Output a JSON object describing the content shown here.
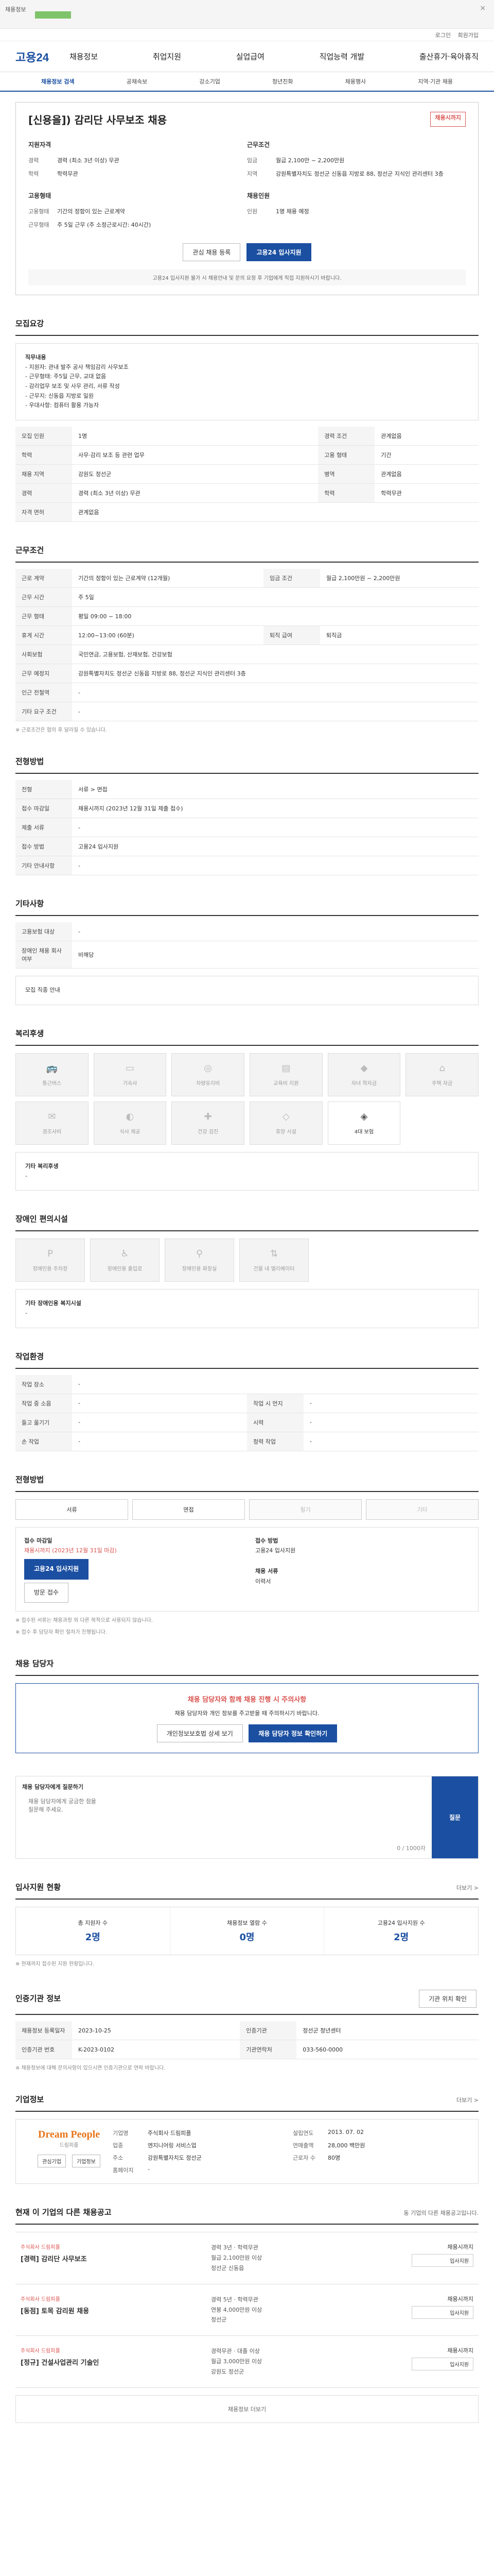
{
  "banner": {
    "label": "채용정보",
    "close": "×"
  },
  "util": {
    "items": [
      "로그인",
      "회원가입"
    ]
  },
  "gnb": {
    "logo": "고용24",
    "menu": [
      "채용정보",
      "취업지원",
      "실업급여",
      "직업능력 개발",
      "출산휴가·육아휴직"
    ]
  },
  "lnb": {
    "items": [
      "채용정보 검색",
      "공채속보",
      "강소기업",
      "청년친화",
      "채용행사",
      "지역·기관 채용"
    ],
    "active": 0
  },
  "job": {
    "title": "[신용을]) 감리단 사무보조 채용",
    "status": "채용시까지",
    "left_head": "지원자격",
    "right_head": "근무조건",
    "left": [
      {
        "k": "경력",
        "v": "경력 (최소 3년 이상) 무관"
      },
      {
        "k": "학력",
        "v": "학력무관"
      }
    ],
    "right": [
      {
        "k": "임금",
        "v": "월급 2,100만 ~ 2,200만원"
      },
      {
        "k": "지역",
        "v": "강원특별자치도 정선군 신동읍 지방로 88, 정선군 지식인 관리센터 3층"
      }
    ],
    "left2_head": "고용형태",
    "left2": [
      {
        "k": "고용형태",
        "v": "기간의 정함이 있는 근로계약"
      },
      {
        "k": "근무형태",
        "v": "주 5일 근무 (주 소정근로시간: 40시간)"
      }
    ],
    "right2_head": "채용인원",
    "right2": [
      {
        "k": "인원",
        "v": "1명 채용 예정"
      }
    ],
    "btn_interest": "관심 채용 등록",
    "btn_apply": "고용24 입사지원",
    "notice": "고용24 입사지원 불가 시 채용안내 및 문의 요청 후 기업에게 직접 지원하시기 바랍니다."
  },
  "recruit": {
    "title": "모집요강",
    "desc_title": "직무내용",
    "desc": [
      "- 지원자: 관내 발주 공사 책임감리 사무보조",
      "- 근무형태: 주5일 근무, 교대 없음",
      "- 감리업무 보조 및 사무 관리, 서류 작성",
      "- 근무지: 신동읍 지방로 일원",
      "- 우대사항: 컴퓨터 활용 가능자"
    ],
    "rows": [
      {
        "k": "모집 인원",
        "v": "1명",
        "k2": "경력 조건",
        "v2": "관계없음"
      },
      {
        "k": "학력",
        "v": "사무·감리 보조 등 관련 업무",
        "k2": "고용 형태",
        "v2": "기간"
      },
      {
        "k": "채용 지역",
        "v": "강원도 정선군",
        "k2": "병역",
        "v2": "관계없음"
      },
      {
        "k": "경력",
        "v": "경력 (최소 3년 이상) 무관",
        "k2": "학력",
        "v2": "학력무관"
      },
      {
        "k": "자격 면허",
        "v": "관계없음",
        "k2": "",
        "v2": ""
      }
    ]
  },
  "conditions": {
    "title": "근무조건",
    "rows": [
      {
        "k": "근로 계약",
        "v": "기간의 정함이 있는 근로계약 (12개월)",
        "k2": "임금 조건",
        "v2": "월급 2,100만원 ~ 2,200만원"
      },
      {
        "k": "근무 시간",
        "v": "주 5일",
        "k2": "",
        "v2": ""
      },
      {
        "k": "근무 형태",
        "v": "평일 09:00 ~ 18:00",
        "k2": "",
        "v2": ""
      },
      {
        "k": "휴게 시간",
        "v": "12:00~13:00 (60분)",
        "k2": "퇴직 급여",
        "v2": "퇴직금"
      },
      {
        "k": "사회보험",
        "v": "국민연금, 고용보험, 산재보험, 건강보험",
        "k2": "",
        "v2": ""
      },
      {
        "k": "근무 예정지",
        "v": "강원특별자치도 정선군 신동읍 지방로 88, 정선군 지식인 관리센터 3층",
        "k2": "",
        "v2": ""
      },
      {
        "k": "인근 전철역",
        "v": "-",
        "k2": "",
        "v2": ""
      },
      {
        "k": "기타 요구 조건",
        "v": "-",
        "k2": "",
        "v2": ""
      }
    ],
    "note": "※ 근로조건은 협의 후 달라질 수 있습니다."
  },
  "selection": {
    "title": "전형방법",
    "rows": [
      {
        "k": "전형",
        "v": "서류 > 면접"
      },
      {
        "k": "접수 마감일",
        "v": "채용시까지 (2023년 12월 31일 제출 접수)"
      },
      {
        "k": "제출 서류",
        "v": "-"
      },
      {
        "k": "접수 방법",
        "v": "고용24 입사지원"
      },
      {
        "k": "기타 안내사항",
        "v": "-"
      }
    ]
  },
  "etc": {
    "title": "기타사항",
    "rows": [
      {
        "k": "고용보험 대상",
        "v": "-"
      },
      {
        "k": "장애인 채용 회사 여부",
        "v": "비해당"
      }
    ],
    "link": "모집 직종 안내"
  },
  "welfare": {
    "title": "복리후생",
    "items": [
      {
        "name": "통근버스",
        "icon": "bus-icon",
        "on": false
      },
      {
        "name": "기숙사",
        "icon": "dorm-icon",
        "on": false
      },
      {
        "name": "차량유지비",
        "icon": "car-icon",
        "on": false
      },
      {
        "name": "교육비 지원",
        "icon": "book-icon",
        "on": false
      },
      {
        "name": "자녀 학자금",
        "icon": "school-icon",
        "on": false
      },
      {
        "name": "주택 자금",
        "icon": "house-icon",
        "on": false
      },
      {
        "name": "경조사비",
        "icon": "gift-icon",
        "on": false
      },
      {
        "name": "식사 제공",
        "icon": "meal-icon",
        "on": false
      },
      {
        "name": "건강 검진",
        "icon": "health-icon",
        "on": false
      },
      {
        "name": "휴양 시설",
        "icon": "rest-icon",
        "on": false
      },
      {
        "name": "4대 보험",
        "icon": "shield-icon",
        "on": true
      }
    ],
    "etc_label": "기타 복리후생",
    "etc_value": "-"
  },
  "facilities": {
    "title": "장애인 편의시설",
    "items": [
      "장애인용 주차장",
      "장애인용 출입로",
      "장애인용 화장실",
      "건물 내 엘리베이터"
    ],
    "etc_label": "기타 장애인용 복지시설",
    "etc_value": "-"
  },
  "workplace": {
    "title": "작업환경",
    "rows": [
      {
        "k": "작업 장소",
        "v": "-",
        "k2": "",
        "v2": ""
      },
      {
        "k": "작업 중 소음",
        "v": "-",
        "k2": "작업 시 먼지",
        "v2": "-"
      },
      {
        "k": "들고 옮기기",
        "v": "-",
        "k2": "시력",
        "v2": "-"
      },
      {
        "k": "손 작업",
        "v": "-",
        "k2": "청력 작업",
        "v2": "-"
      }
    ]
  },
  "apply": {
    "title": "전형방법",
    "methods": [
      {
        "label": "서류",
        "on": true
      },
      {
        "label": "면접",
        "on": true
      },
      {
        "label": "필기",
        "on": false
      },
      {
        "label": "기타",
        "on": false
      }
    ],
    "left_title": "접수 마감일",
    "left_value": "채용시까지 (2023년 12월 31일 마감)",
    "left_btn": "고용24 입사지원",
    "left_btn2": "방문 접수",
    "right_title": "접수 방법",
    "right_value": "고용24 입사지원",
    "right_note": "채용 서류",
    "right_note_v": "이력서",
    "notes": [
      "※ 접수된 서류는 채용과정 외 다른 목적으로 사용되지 않습니다.",
      "※ 접수 후 담당자 확인 절차가 진행됩니다."
    ]
  },
  "docs": {
    "title": "채용 담당자",
    "alert": "채용 담당자와 함께 채용 진행 시 주의사항",
    "body": "채용 담당자와 개인 정보를 주고받을 때 주의하시기 바랍니다.",
    "btn1": "개인정보보호법 상세 보기",
    "btn2": "채용 담당자 정보 확인하기"
  },
  "qa": {
    "title": "채용 담당자에게 질문하기",
    "placeholder": "채용 담당자에게 궁금한 점을 질문해 주세요.",
    "count": "0 / 1000자",
    "send": "질문"
  },
  "status": {
    "title": "입사지원 현황",
    "more": "더보기 >",
    "items": [
      {
        "label": "총 지원자 수",
        "value": "2명"
      },
      {
        "label": "채용정보 열람 수",
        "value": "0명"
      },
      {
        "label": "고용24 입사지원 수",
        "value": "2명"
      }
    ],
    "note": "※ 현재까지 접수된 지원 현황입니다."
  },
  "contact": {
    "title": "인증기관 정보",
    "btn": "기관 위치 확인",
    "rows": [
      {
        "k": "채용정보 등록일자",
        "v": "2023-10-25",
        "k2": "인증기관",
        "v2": "정선군 청년센터"
      },
      {
        "k": "인증기관 번호",
        "v": "K-2023-0102",
        "k2": "기관연락처",
        "v2": "033-560-0000"
      }
    ],
    "note": "※ 채용정보에 대해 문의사항이 있으시면 인증기관으로 연락 바랍니다."
  },
  "company": {
    "title": "기업정보",
    "more": "더보기 >",
    "logo": "Dream People",
    "logo_sub": "드림피플",
    "btn1": "관심기업",
    "btn2": "기업정보",
    "rows": [
      {
        "k": "기업명",
        "v": "주식회사 드림피플",
        "k2": "설립연도",
        "v2": "2013. 07. 02"
      },
      {
        "k": "업종",
        "v": "엔지니어링 서비스업",
        "k2": "연매출액",
        "v2": "28,000 백만원"
      },
      {
        "k": "주소",
        "v": "강원특별자치도 정선군",
        "k2": "근로자 수",
        "v2": "80명"
      },
      {
        "k": "홈페이지",
        "v": "-",
        "k2": "",
        "v2": ""
      }
    ]
  },
  "others": {
    "title": "현재 이 기업의 다른 채용공고",
    "note": "동 기업의 다른 채용공고입니다.",
    "jobs": [
      {
        "company": "주식회사 드림피플",
        "title": "[경력] 감리단 사무보조",
        "meta": [
          "경력 3년 · 학력무관",
          "월급 2,100만원 이상",
          "정선군 신동읍"
        ],
        "deadline": "채용시까지",
        "btn": "입사지원"
      },
      {
        "company": "주식회사 드림피플",
        "title": "[동점] 토목 감리원 채용",
        "meta": [
          "경력 5년 · 학력무관",
          "연봉 4,000만원 이상",
          "정선군"
        ],
        "deadline": "채용시까지",
        "btn": "입사지원"
      },
      {
        "company": "주식회사 드림피플",
        "title": "[정규] 건설사업관리 기술인",
        "meta": [
          "경력무관 · 대졸 이상",
          "월급 3,000만원 이상",
          "강원도 정선군"
        ],
        "deadline": "채용시까지",
        "btn": "입사지원"
      }
    ],
    "more_label": "채용정보 더보기"
  }
}
